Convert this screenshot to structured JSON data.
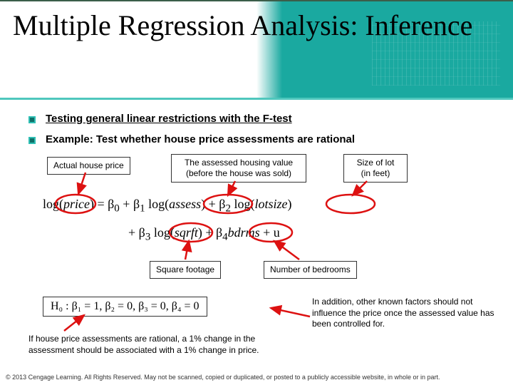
{
  "title": "Multiple Regression Analysis: Inference",
  "bullets": {
    "b1": "Testing general linear restrictions with the F-test",
    "b2": "Example: Test whether house price assessments are rational"
  },
  "labels": {
    "actual": "Actual house price",
    "assessed_l1": "The assessed housing value",
    "assessed_l2": "(before the house was sold)",
    "lot_l1": "Size of lot",
    "lot_l2": "(in feet)",
    "sqft": "Square footage",
    "bdrms": "Number of bedrooms"
  },
  "equation": {
    "part1_a": "log(",
    "part1_price": "price",
    "part1_b": ") = β",
    "sub0": "0",
    "plus": " + β",
    "sub1": "1",
    "log_open": " log(",
    "assess": "assess",
    "close": ")",
    "sub2": "2",
    "lotsize": "lotsize",
    "line2_pref": "+ β",
    "sub3": "3",
    "sqrft": "sqrft",
    "sub4": "4",
    "bdrms": "bdrms",
    "plus_u": " + u"
  },
  "h0": "H₀ : β₁ = 1, β₂ = 0, β₃ = 0, β₄ = 0",
  "caption_left": "If house price assessments are rational, a 1% change in the assessment should be associated with a 1% change in price.",
  "caption_right": "In addition, other known factors should not influence the price once the assessed value has been controlled for.",
  "footer": "© 2013 Cengage Learning. All Rights Reserved. May not be scanned, copied or duplicated, or posted to a publicly accessible website, in whole or in part."
}
